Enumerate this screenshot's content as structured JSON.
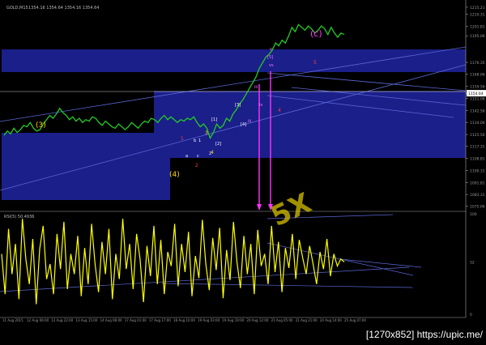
{
  "window": {
    "symbol_header": "GOLD,M15",
    "quote": "1354.16 1354.64 1354.16 1354.64"
  },
  "watermark": {
    "text": "5X"
  },
  "footer": {
    "url": "[1270x852] https://upic.me/"
  },
  "colors": {
    "background": "#000000",
    "price_line": "#22cc22",
    "rsi_line": "#ffff00",
    "zone": "#1b1f8a",
    "trend_line": "#5b67d6",
    "axis_text": "#9a9a9a",
    "magenta": "#ff33ff",
    "wave_yellow": "#ffd700",
    "wave_red": "#ff3b3b",
    "wave_white": "#ffffff",
    "wave_pink": "#ff77ff",
    "current_price_label_bg": "#ffffff",
    "current_price_label_text": "#000000"
  },
  "chart_data": [
    {
      "type": "line",
      "series": [
        {
          "values": [
            1125,
            1128,
            1126,
            1130,
            1127,
            1129,
            1132,
            1131,
            1134,
            1130,
            1128,
            1129,
            1133,
            1136,
            1139,
            1137,
            1140,
            1144,
            1141,
            1139,
            1136,
            1138,
            1135,
            1137,
            1134,
            1136,
            1135,
            1138,
            1137,
            1134,
            1132,
            1135,
            1133,
            1131,
            1130,
            1133,
            1131,
            1129,
            1131,
            1134,
            1132,
            1130,
            1133,
            1135,
            1134,
            1137,
            1136,
            1134,
            1137,
            1139,
            1136,
            1138,
            1136,
            1134,
            1136,
            1135,
            1137,
            1136,
            1138,
            1134,
            1131,
            1133,
            1130,
            1123,
            1127,
            1133,
            1130,
            1132,
            1137,
            1135,
            1140,
            1143,
            1147,
            1150,
            1154,
            1158,
            1162,
            1166,
            1172,
            1176,
            1180,
            1182,
            1185,
            1190,
            1188,
            1192,
            1190,
            1195,
            1201,
            1198,
            1203,
            1201,
            1199,
            1202,
            1200,
            1197,
            1199,
            1202,
            1200,
            1196,
            1201,
            1197,
            1194,
            1197,
            1196
          ]
        }
      ],
      "yaxis": {
        "ticks": [
          "1215.21",
          "1210.31",
          "1201.81",
          "1195.06",
          "1176.35",
          "1168.06",
          "1159.56",
          "1154.64",
          "1151.06",
          "1142.56",
          "1134.06",
          "1125.56",
          "1117.31",
          "1108.81",
          "1100.31",
          "1091.81",
          "1083.31",
          "1075.06"
        ],
        "current_price": "1154.64"
      },
      "wave_labels": [
        {
          "text": "(c)",
          "color_key": "magenta"
        },
        {
          "text": "(3)",
          "color_key": "wave_yellow"
        },
        {
          "text": "(4)",
          "color_key": "wave_yellow"
        },
        {
          "text": "1",
          "color_key": "wave_red"
        },
        {
          "text": "2",
          "color_key": "wave_red"
        },
        {
          "text": "3",
          "color_key": "wave_yellow"
        },
        {
          "text": "4",
          "color_key": "wave_yellow"
        },
        {
          "text": "4",
          "color_key": "wave_red"
        },
        {
          "text": "5",
          "color_key": "wave_red"
        },
        {
          "text": "a",
          "color_key": "wave_white"
        },
        {
          "text": "b",
          "color_key": "wave_white"
        },
        {
          "text": "c",
          "color_key": "wave_white"
        },
        {
          "text": "1",
          "color_key": "wave_white"
        },
        {
          "text": "2",
          "color_key": "wave_white"
        },
        {
          "text": "[1]",
          "color_key": "wave_white"
        },
        {
          "text": "[2]",
          "color_key": "wave_white"
        },
        {
          "text": "[3]",
          "color_key": "wave_white"
        },
        {
          "text": "[4]",
          "color_key": "wave_white"
        },
        {
          "text": "[5]",
          "color_key": "wave_pink"
        },
        {
          "text": "iii",
          "color_key": "wave_pink"
        },
        {
          "text": "iv",
          "color_key": "wave_pink"
        },
        {
          "text": "v",
          "color_key": "wave_pink"
        },
        {
          "text": "vs",
          "color_key": "wave_pink"
        },
        {
          "text": "iii",
          "color_key": "wave_pink"
        }
      ]
    },
    {
      "type": "line",
      "title": "RSI(5) 50.4936",
      "yaxis": {
        "ticks": [
          "100",
          "52",
          "0"
        ]
      },
      "series": [
        {
          "values": [
            60,
            20,
            85,
            40,
            70,
            15,
            95,
            55,
            30,
            75,
            10,
            65,
            88,
            35,
            50,
            20,
            80,
            45,
            92,
            25,
            60,
            40,
            78,
            18,
            66,
            30,
            90,
            50,
            22,
            72,
            40,
            85,
            15,
            60,
            35,
            95,
            45,
            70,
            25,
            80,
            55,
            12,
            68,
            38,
            88,
            30,
            74,
            20,
            62,
            48,
            90,
            28,
            70,
            42,
            82,
            18,
            58,
            36,
            94,
            50,
            24,
            76,
            44,
            86,
            16,
            64,
            34,
            92,
            52,
            26,
            78,
            40,
            70,
            20,
            84,
            48,
            60,
            30,
            88,
            42,
            72,
            22,
            66,
            46,
            80,
            35,
            74,
            56,
            40,
            68,
            50,
            30,
            62,
            45,
            75,
            38,
            60,
            48,
            55,
            52
          ]
        }
      ],
      "xaxis": {
        "ticks": [
          "11 Aug 2015",
          "12 Aug 06:00",
          "12 Aug 22:00",
          "13 Aug 15:00",
          "14 Aug 08:00",
          "17 Aug 01:00",
          "17 Aug 17:00",
          "18 Aug 10:00",
          "19 Aug 03:00",
          "19 Aug 19:00",
          "20 Aug 12:00",
          "21 Aug 05:00",
          "21 Aug 21:00",
          "24 Aug 14:00",
          "25 Aug 07:00"
        ]
      }
    }
  ]
}
